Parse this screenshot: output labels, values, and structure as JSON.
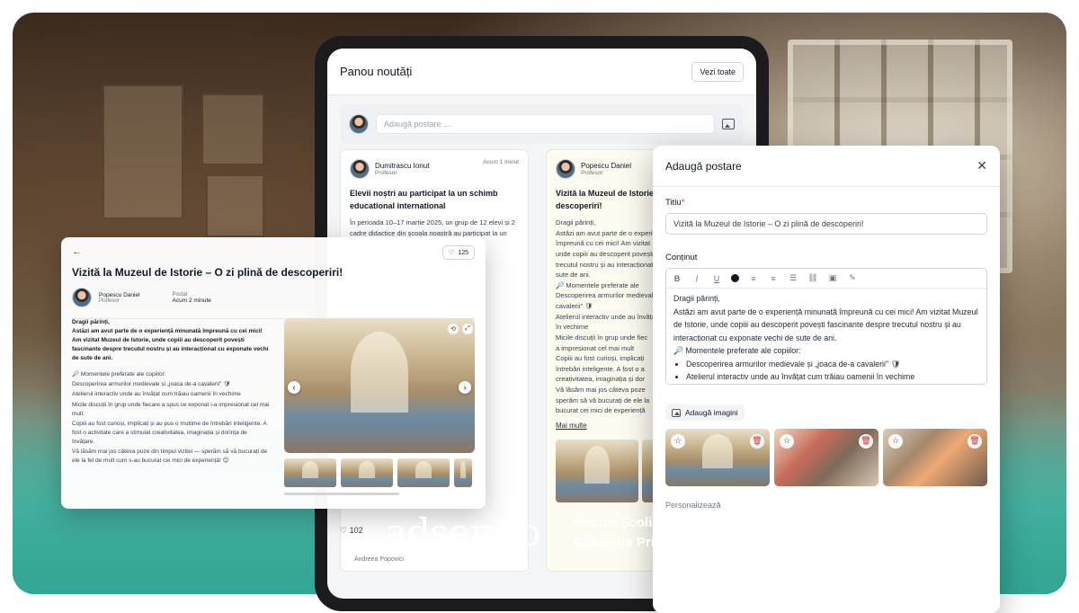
{
  "feed": {
    "title": "Panou noutăți",
    "see_all": "Vezi toate",
    "composer_placeholder": "Adaugă postare ...",
    "posts": [
      {
        "author": "Dumitrascu Ionut",
        "role": "Profesor",
        "time": "Acum 1 minut",
        "title": "Elevii noștri au participat la un schimb educational international",
        "body": "În perioada 10–17 martie 2025, un grup de 12 elevi și 2 cadre didactice din școala noastră au participat la un",
        "likes": "102"
      },
      {
        "author": "Popescu Daniel",
        "role": "Profesor",
        "title": "Vizită la Muzeul de Istorie – O zi plină de descoperiri!",
        "body_lines": [
          "Dragii părinți,",
          "Astăzi am avut parte de o experiență",
          "împreună cu cei mici! Am vizitat",
          "unde copiii au descoperit povești",
          "trecutul nostru și au interacționat",
          "sute de ani.",
          "🔎 Momentele preferate ale",
          "Descoperirea armurilor medievale",
          "cavalerii\" 🛡",
          "Atelierul interactiv unde au învățat",
          "în vechime",
          "Micile discuții în grup unde fiec",
          "a impresionat cel mai mult",
          "Copiii au fost curioși, implicați",
          "întrebări inteligente. A fost o a",
          "creativitatea, imaginația și dor",
          "Vă lăsăm mai jos câteva poze",
          "sperăm să vă bucurați de ele la",
          "bucurat cei mici de experiență"
        ],
        "more": "Mai multe"
      }
    ],
    "bottom_author": "Andreea Popovici"
  },
  "detail": {
    "likes": "125",
    "title": "Vizită la Muzeul de Istorie – O zi plină de descoperiri!",
    "author": "Popescu Daniel",
    "role": "Profesor",
    "posted_label": "Postat",
    "posted_value": "Acum 2 minute",
    "greeting": "Dragii părinți,",
    "intro": "Astăzi am avut parte de o experiență minunată împreună cu cei mici! Am vizitat Muzeul de Istorie, unde copiii au descoperit povești fascinante despre trecutul nostru și au interacționat cu exponate vechi de sute de ani.",
    "lines": [
      "🔎 Momentele preferate ale copiilor:",
      "Descoperirea armurilor medievale și „joaca de-a cavalerii\" 🛡",
      "Atelierul interactiv unde au învățat cum trăiau oamenii în vechime",
      "Micile discuții în grup unde fiecare a spus ce exponat i-a impresionat cel mai mult.",
      "Copiii au fost curioși, implicați și au pus o mulțime de întrebări inteligente. A fost o activitate care a stimulat creativitatea, imaginația și dorința de învățare.",
      "Vă lăsăm mai jos câteva poze din timpul vizitei — sperăm să vă bucurați de ele la fel de mult cum s-au bucurat cei mici de experiență! 😊"
    ]
  },
  "modal": {
    "title": "Adaugă postare",
    "title_label": "Titlu",
    "required_mark": "*",
    "title_value": "Vizită la Muzeul de Istorie – O zi plină de descoperiri!",
    "content_label": "Conținut",
    "content": {
      "l1": "Dragii părinți,",
      "l2": "Astăzi am avut parte de o experiență minunată împreună cu cei mici! Am vizitat Muzeul de Istorie, unde copiii au descoperit povești fascinante despre trecutul nostru și au interacționat cu exponate vechi de sute de ani.",
      "l3": "🔎 Momentele preferate ale copiilor:",
      "b1": "Descoperirea armurilor medievale și „joaca de-a cavalerii\" 🛡",
      "b2": "Atelierul interactiv unde au învățat cum trăiau oamenii în vechime"
    },
    "add_images": "Adaugă imagini",
    "personalize": "Personalizează"
  },
  "brand": {
    "logo": "adservio",
    "tagline_line1": "Pentru Școli &",
    "tagline_line2": "Grădinițe Private"
  }
}
